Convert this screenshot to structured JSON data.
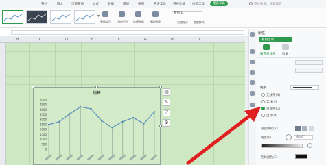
{
  "menu": {
    "items": [
      "开始",
      "插入",
      "页面布局",
      "公式",
      "数据",
      "审阅",
      "视图",
      "开发工具",
      "特色功能",
      "绘图工具",
      "图表工具"
    ],
    "active_index": 10,
    "search_placeholder": "查找命令、搜索模板"
  },
  "ribbon": {
    "tools": [
      "更改类型",
      "切换行列",
      "选择数据",
      "移动图表"
    ],
    "combo_value": "系列 1",
    "tools2": [
      "设置格式",
      "重置样式"
    ]
  },
  "sheet": {
    "columns": [
      "B",
      "C",
      "D",
      "E",
      "F",
      "G",
      "H",
      "I"
    ]
  },
  "chart": {
    "title": "销售",
    "y_ticks": [
      "5000",
      "4500",
      "4000",
      "3500",
      "3000",
      "2500",
      "2000",
      "1500",
      "1000",
      "500",
      "0"
    ],
    "side_buttons": [
      "layers-icon",
      "brush-icon",
      "filter-icon",
      "gear-icon"
    ]
  },
  "chart_data": {
    "type": "line",
    "title": "销售",
    "ylim": [
      0,
      5000
    ],
    "values": [
      2500,
      2800,
      3600,
      4300,
      4100,
      2900,
      2200,
      2800,
      3200,
      2600,
      3800
    ]
  },
  "panel": {
    "title": "属性",
    "tabs": [
      "填充与线条",
      "效果"
    ],
    "dropdown_label": "系列选项",
    "line_section": "线条",
    "line_options": [
      "无线条(N)",
      "实线(S)",
      "渐变线(G)",
      "自动(U)"
    ],
    "selected_option": 2,
    "labels": [
      "渐变样式(R)",
      "角度(E)",
      "色标颜色(C)"
    ],
    "angle_value": "90.0°"
  },
  "colors": {
    "accent": "#2e9a4d",
    "sheet_bg": "#cfe8c4",
    "line": "#5d8fc0"
  }
}
